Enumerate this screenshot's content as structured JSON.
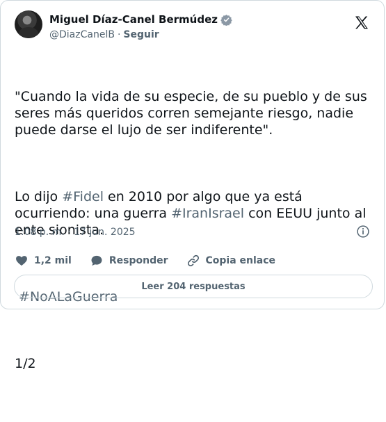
{
  "author": {
    "name": "Miguel Díaz-Canel Bermúdez",
    "handle": "@DiazCanelB",
    "separator": "·",
    "follow_label": "Seguir"
  },
  "icons": {
    "verified": "verified-badge-icon",
    "platform": "x-logo-icon",
    "info": "info-icon",
    "like": "heart-icon",
    "reply": "speech-bubble-icon",
    "copy_link": "link-icon"
  },
  "post": {
    "quote": "\"Cuando la vida de su especie, de su pueblo y de sus seres más queridos corren semejante riesgo, nadie puede darse el lujo de ser indiferente\".",
    "p2_a": "Lo dijo ",
    "p2_tag1": "#Fidel",
    "p2_b": " en 2010 por algo que ya está ocurriendo: una guerra ",
    "p2_tag2": "#IranIsrael",
    "p2_c": " con EEUU junto al ente sionista.",
    "hashtag3": " #NoALaGuerra",
    "counter": "1/2"
  },
  "meta": {
    "timestamp": "1:08 p. m. · 17 jun. 2025"
  },
  "actions": {
    "likes": "1,2 mil",
    "reply_label": "Responder",
    "copy_label": "Copia enlace",
    "read_replies": "Leer 204 respuestas"
  },
  "colors": {
    "text": "#0f1419",
    "secondary": "#536471",
    "border": "#cfd9de"
  }
}
